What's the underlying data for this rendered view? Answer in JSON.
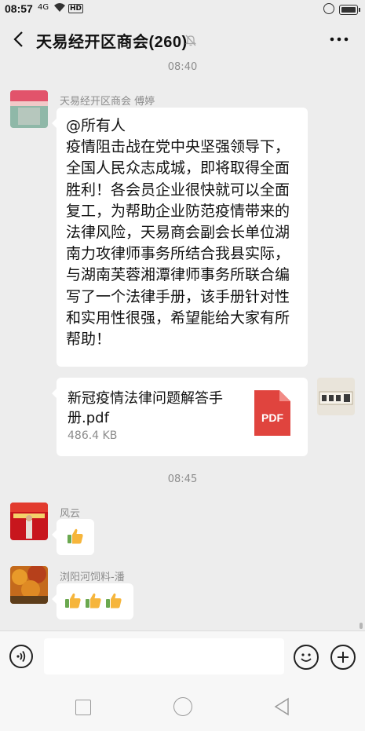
{
  "status_bar": {
    "time": "08:57",
    "signal": "4G",
    "hd": "HD"
  },
  "header": {
    "title": "天易经开区商会(260)"
  },
  "messages": {
    "time1": "08:40",
    "msg1": {
      "sender": "天易经开区商会 傅婷",
      "lines": [
        "@所有人",
        "疫情阻击战在党中央坚强领导下，",
        "全国人民众志成城，即将取得全面",
        "胜利！各会员企业很快就可以全面",
        "复工，为帮助企业防范疫情带来的",
        "法律风险，天易商会副会长单位湖",
        "南力攻律师事务所结合我县实际，",
        "与湖南芙蓉湘潭律师事务所联合编",
        "写了一个法律手册，该手册针对性",
        "和实用性很强，希望能给大家有所",
        "帮助！"
      ]
    },
    "file": {
      "name_line1": "新冠疫情法律问题解答手",
      "name_line2": "册.pdf",
      "size": "486.4 KB",
      "icon_label": "PDF",
      "icon_color": "#e0443e"
    },
    "time2": "08:45",
    "msg2": {
      "sender": "风云",
      "emoji": "thumbs-up"
    },
    "msg3": {
      "sender": "浏阳河饲料-潘",
      "emoji_count": 3
    }
  },
  "input": {
    "placeholder": ""
  },
  "colors": {
    "background": "#ededed",
    "bubble": "#ffffff",
    "meta_text": "#8c8c8c"
  }
}
